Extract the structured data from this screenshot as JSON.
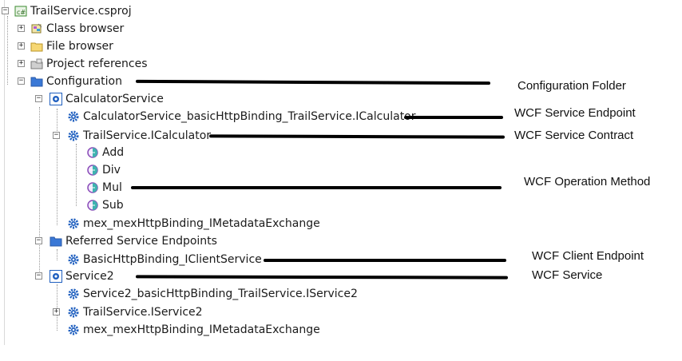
{
  "tree": {
    "root": "TrailService.csproj",
    "items": {
      "class_browser": "Class browser",
      "file_browser": "File browser",
      "project_references": "Project references",
      "configuration": "Configuration",
      "calculator_service": "CalculatorService",
      "calc_endpoint": "CalculatorService_basicHttpBinding_TrailService.ICalculator",
      "icalculator": "TrailService.ICalculator",
      "op_add": "Add",
      "op_div": "Div",
      "op_mul": "Mul",
      "op_sub": "Sub",
      "mex1": "mex_mexHttpBinding_IMetadataExchange",
      "referred_endpoints": "Referred Service Endpoints",
      "client_endpoint": "BasicHttpBinding_IClientService",
      "service2": "Service2",
      "service2_endpoint": "Service2_basicHttpBinding_TrailService.IService2",
      "iservice2": "TrailService.IService2",
      "mex2": "mex_mexHttpBinding_IMetadataExchange"
    }
  },
  "annotations": {
    "configuration_folder": "Configuration Folder",
    "service_endpoint": "WCF Service Endpoint",
    "service_contract": "WCF Service Contract",
    "operation_method": "WCF Operation Method",
    "client_endpoint": "WCF Client Endpoint",
    "service": "WCF Service"
  },
  "colors": {
    "folder_blue": "#3a78d6",
    "gear_blue": "#1f5fbf",
    "operation_purple": "#8a4cb8",
    "operation_teal": "#3fb3b0"
  }
}
